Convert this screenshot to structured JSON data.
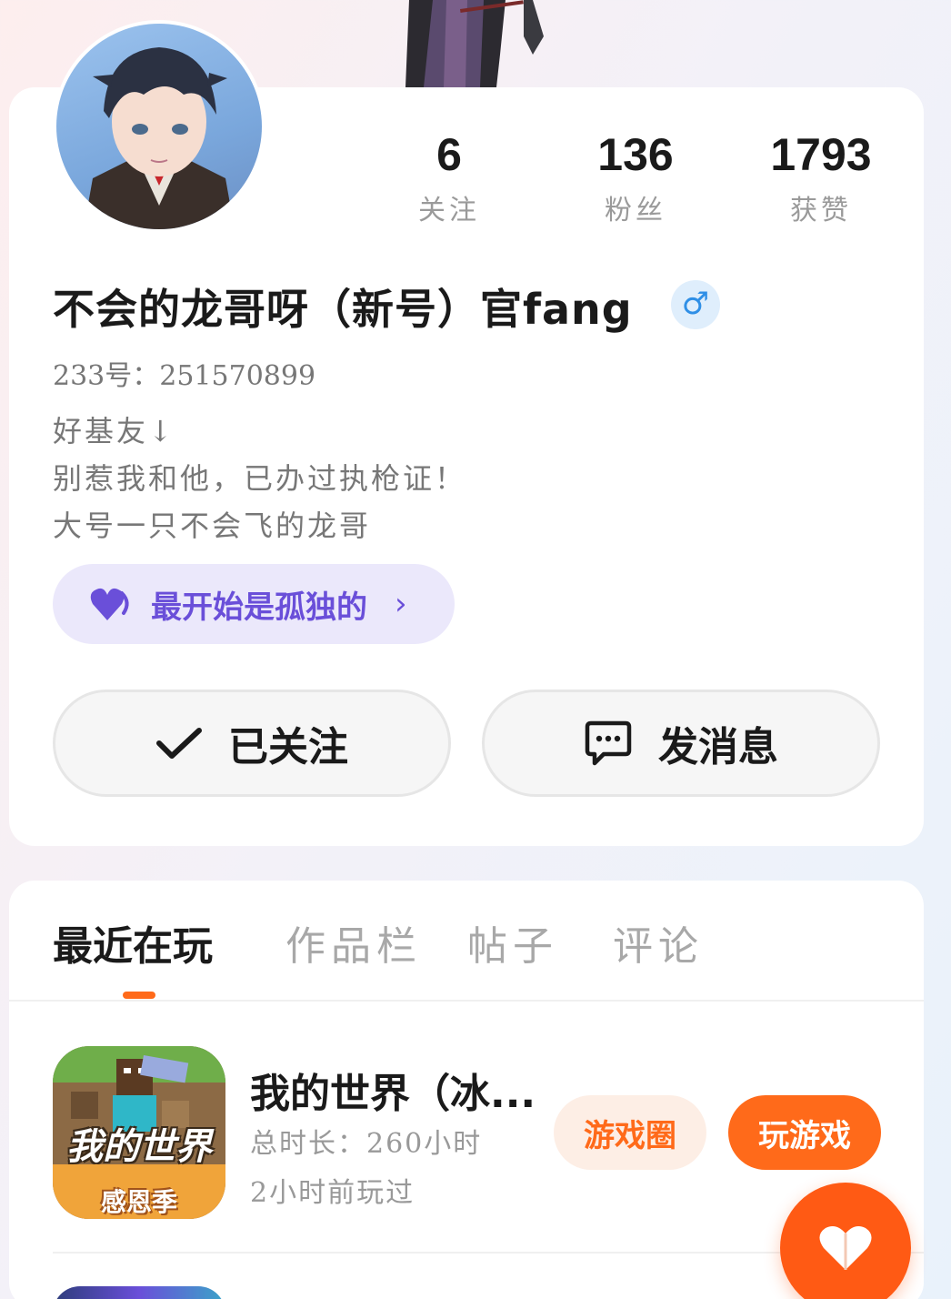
{
  "stats": [
    {
      "value": "6",
      "label": "关注"
    },
    {
      "value": "136",
      "label": "粉丝"
    },
    {
      "value": "1793",
      "label": "获赞"
    }
  ],
  "profile": {
    "name": "不会的龙哥呀（新号）官fang",
    "gender_symbol": "♂",
    "uid": "233号：251570899",
    "bio": [
      "好基友↓",
      "别惹我和他，已办过执枪证！",
      "大号一只不会飞的龙哥"
    ]
  },
  "badge": {
    "text": "最开始是孤独的",
    "chevron": "›"
  },
  "actions": {
    "follow_label": "已关注",
    "message_label": "发消息"
  },
  "tabs": [
    "最近在玩",
    "作品栏",
    "帖子",
    "评论"
  ],
  "game": {
    "title": "我的世界（冰...",
    "icon_text": "我的世界",
    "icon_subtext": "感恩季",
    "total_time": "总时长：260小时",
    "last_played": "2小时前玩过",
    "circle_label": "游戏圈",
    "play_label": "玩游戏"
  },
  "colors": {
    "accent": "#ff6a1a",
    "badge_purple": "#6a4fd9",
    "gender_blue": "#2f8fe6"
  },
  "icons": [
    "check-icon",
    "chat-bubble-icon",
    "heart-icon",
    "chevron-right-icon",
    "male-icon"
  ]
}
